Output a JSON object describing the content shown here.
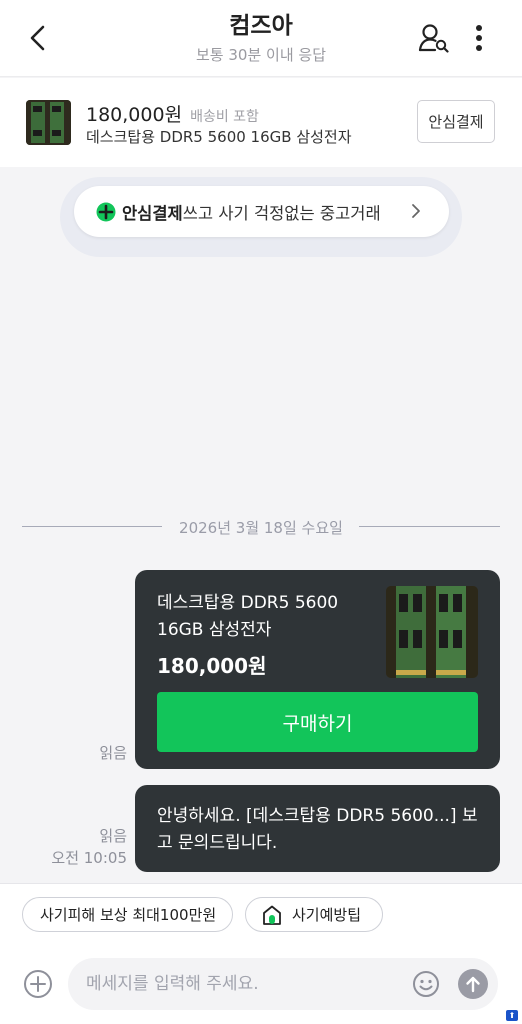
{
  "header": {
    "title": "컴즈아",
    "subtitle": "보통 30분 이내 응답",
    "icons": {
      "back": "chevron-left-icon",
      "profile": "user-search-icon",
      "more": "more-vertical-icon"
    }
  },
  "product": {
    "price": "180,000원",
    "shipping": "배송비 포함",
    "name": "데스크탑용 DDR5 5600 16GB 삼성전자",
    "safe_pay_label": "안심결제"
  },
  "banner": {
    "bold": "안심결제",
    "text": "쓰고 사기 걱정없는 중고거래",
    "icon": "green-plus-icon"
  },
  "chat": {
    "date": "2026년 3월 18일 수요일",
    "card": {
      "name": "데스크탑용 DDR5 5600 16GB 삼성전자",
      "price": "180,000원",
      "buy_label": "구매하기",
      "read_label": "읽음"
    },
    "message": {
      "text": "안녕하세요. [데스크탑용 DDR5 5600...] 보고 문의드립니다.",
      "read_label": "읽음",
      "time": "오전 10:05"
    }
  },
  "chips": [
    {
      "label": "사기피해 보상 최대100만원"
    },
    {
      "label": "사기예방팁",
      "icon": "house-shield-icon"
    }
  ],
  "composer": {
    "placeholder": "메세지를 입력해 주세요.",
    "value": ""
  },
  "colors": {
    "accent_green": "#12c55a",
    "bubble_dark": "#2f3437",
    "background": "#f4f4f6"
  }
}
